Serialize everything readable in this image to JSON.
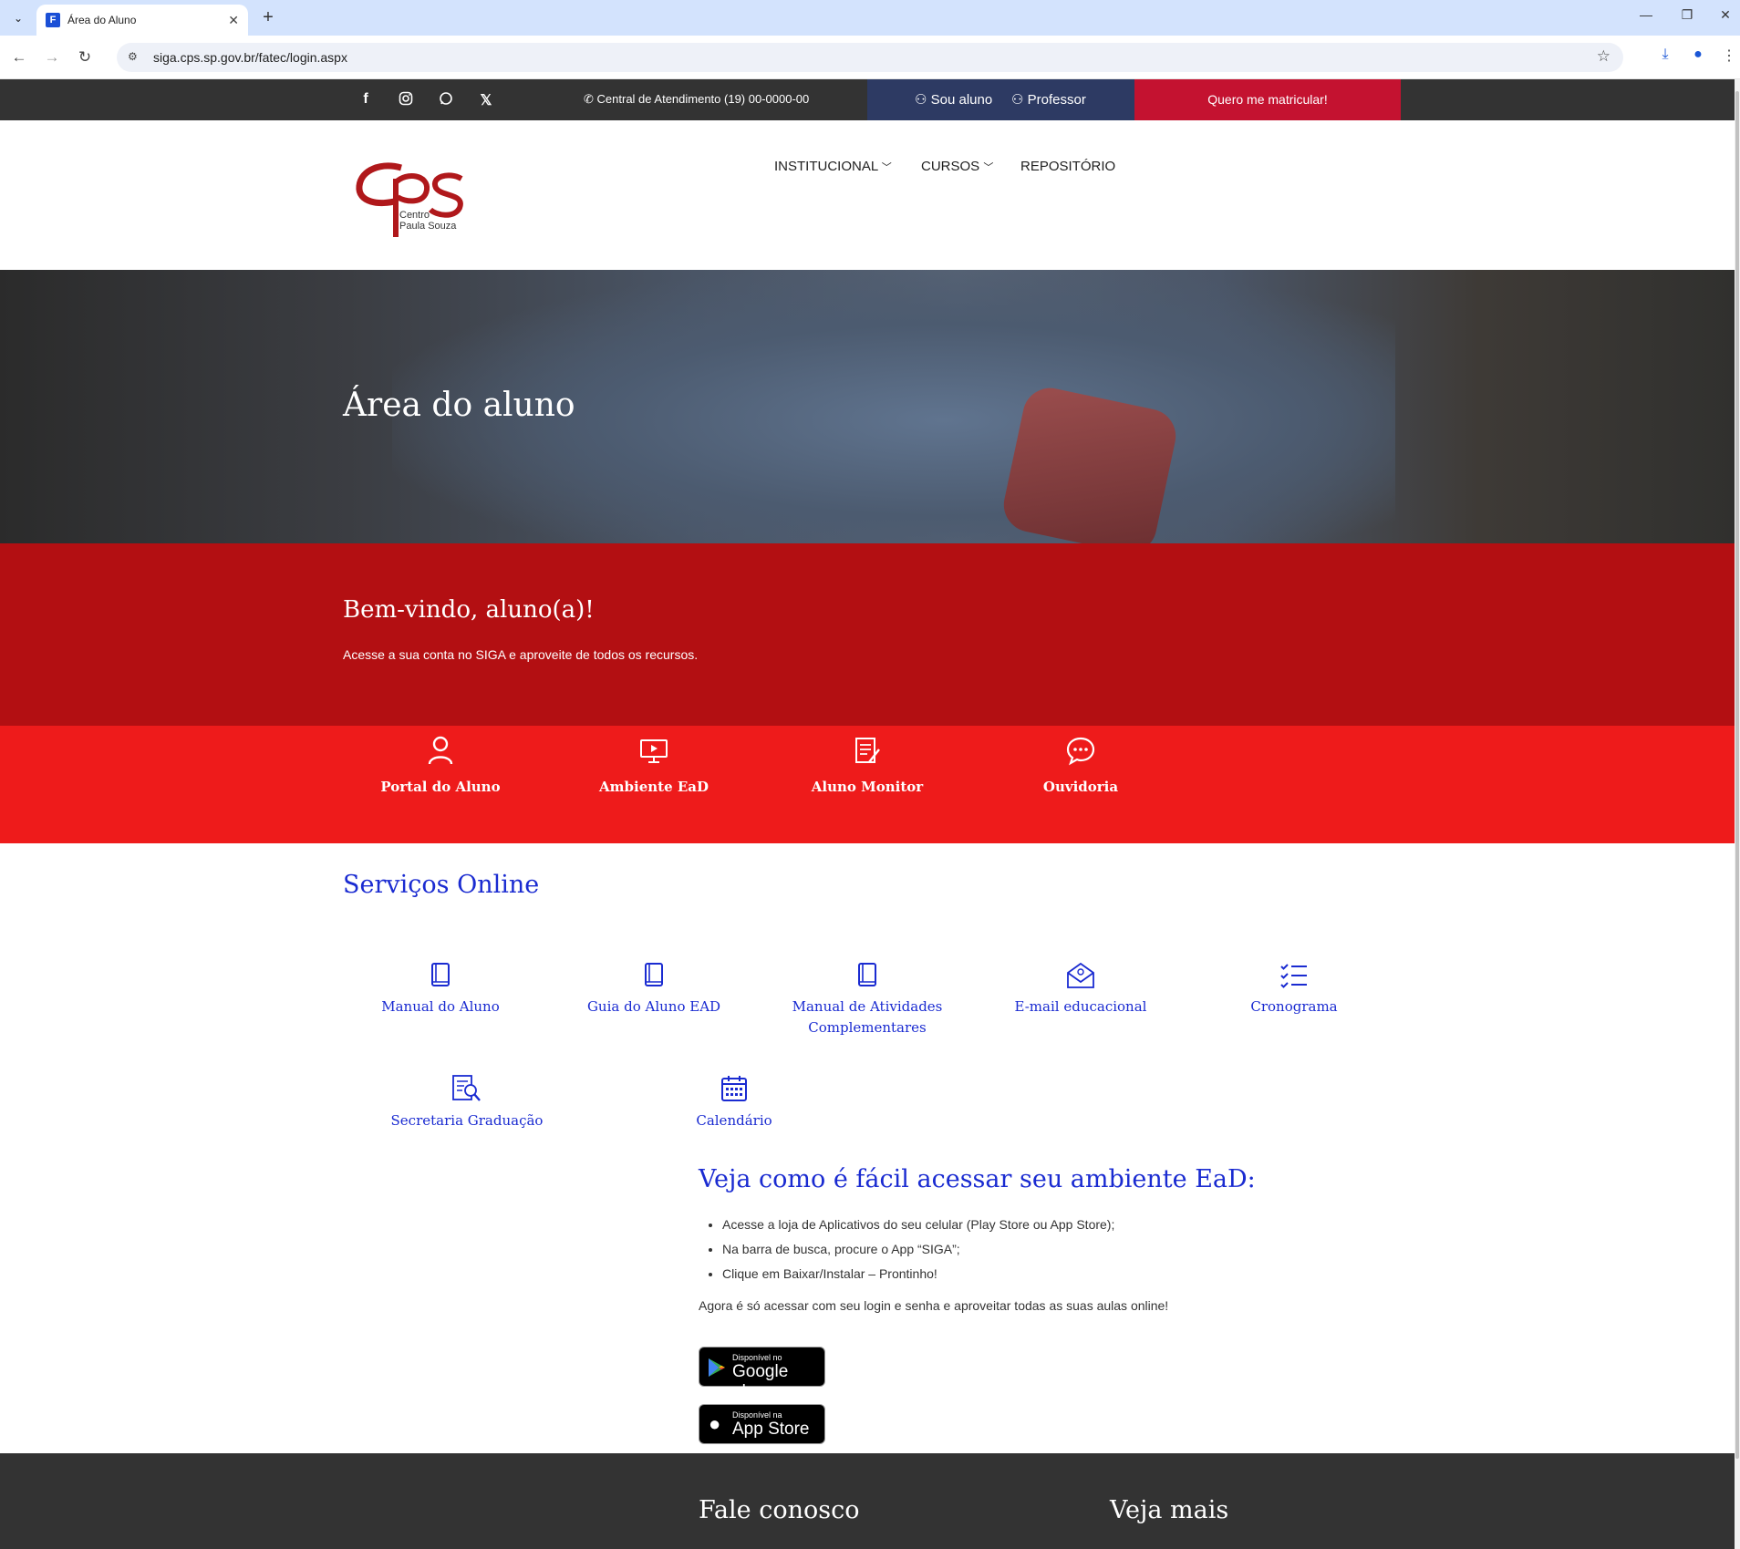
{
  "browser": {
    "tab_title": "Área do Aluno",
    "url": "siga.cps.sp.gov.br/fatec/login.aspx"
  },
  "topbar": {
    "contact": "Central de Atendimento (19) 00-0000-00",
    "student_link": "Sou aluno",
    "teacher_link": "Professor",
    "enroll_button": "Quero me matricular!",
    "social_icons": [
      "facebook-icon",
      "instagram-icon",
      "whatsapp-icon",
      "x-icon"
    ]
  },
  "header": {
    "logo_text_line1": "Centro",
    "logo_text_line2": "Paula Souza",
    "nav": [
      "INSTITUCIONAL",
      "CURSOS",
      "REPOSITÓRIO"
    ]
  },
  "hero": {
    "title": "Área do aluno"
  },
  "welcome": {
    "title": "Bem-vindo, aluno(a)!",
    "subtitle": "Acesse a sua conta no SIGA e aproveite de todos os recursos."
  },
  "quick_links": [
    {
      "label": "Portal do Aluno",
      "icon": "user-icon"
    },
    {
      "label": "Ambiente EaD",
      "icon": "monitor-icon"
    },
    {
      "label": "Aluno Monitor",
      "icon": "notepad-icon"
    },
    {
      "label": "Ouvidoria",
      "icon": "chat-icon"
    }
  ],
  "services": {
    "title": "Serviços Online",
    "items": [
      {
        "label": "Manual do Aluno",
        "icon": "book-icon"
      },
      {
        "label": "Guia do Aluno EAD",
        "icon": "book-icon"
      },
      {
        "label": "Manual de Atividades Complementares",
        "icon": "book-icon"
      },
      {
        "label": "E-mail educacional",
        "icon": "envelope-icon"
      },
      {
        "label": "Cronograma",
        "icon": "checklist-icon"
      },
      {
        "label": "Secretaria Graduação",
        "icon": "document-search-icon"
      },
      {
        "label": "Calendário",
        "icon": "calendar-icon"
      }
    ]
  },
  "ead": {
    "title": "Veja como é fácil acessar seu ambiente EaD:",
    "steps": [
      "Acesse a loja de Aplicativos do seu celular (Play Store ou App Store);",
      "Na barra de busca, procure o App “SIGA”;",
      "Clique em Baixar/Instalar – Prontinho!"
    ],
    "note": "Agora é só acessar com seu login e senha e aproveitar todas as suas aulas online!",
    "google_play_small": "Disponível no",
    "google_play_big": "Google play",
    "app_store_small": "Disponível na",
    "app_store_big": "App Store"
  },
  "footer": {
    "col1_title": "Fale conosco",
    "col2_title": "Veja mais"
  },
  "colors": {
    "dark_red": "#b30f12",
    "bright_red": "#ee1b1b",
    "link_blue": "#1a2bd1",
    "topbar_dark": "#333333",
    "login_navy": "#2d3a63",
    "enroll_red": "#c41230"
  }
}
